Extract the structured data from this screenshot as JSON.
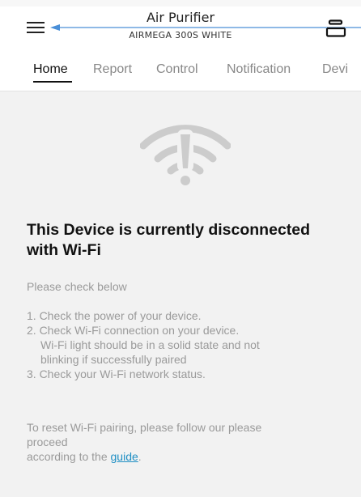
{
  "header": {
    "title": "Air Purifier",
    "subtitle": "AIRMEGA 300S WHITE"
  },
  "tabs": [
    {
      "label": "Home",
      "active": true
    },
    {
      "label": "Report"
    },
    {
      "label": "Control"
    },
    {
      "label": "Notification"
    },
    {
      "label": "Devi"
    }
  ],
  "status": {
    "heading": "This Device is currently disconnected with Wi-Fi",
    "check_label": "Please check below",
    "steps": [
      "1. Check the power of your device.",
      "2. Check Wi-Fi connection on your device.",
      "Wi-Fi light should be in a solid state and not",
      "blinking if successfully paired",
      "3. Check your Wi-Fi network status."
    ],
    "reset_line1": "To reset Wi-Fi pairing, please follow our please",
    "reset_line2": "proceed",
    "reset_line3_prefix": "according to the ",
    "guide_link": "guide",
    "reset_line3_suffix": "."
  },
  "colors": {
    "background": "#f2f2f2",
    "link": "#1f8fc4",
    "annotation_arrow": "#4a8fd8",
    "wifi_icon": "#cccccc"
  },
  "icons": [
    "hamburger-menu-icon",
    "device-stack-icon",
    "wifi-warning-icon",
    "arrow-annotation"
  ]
}
